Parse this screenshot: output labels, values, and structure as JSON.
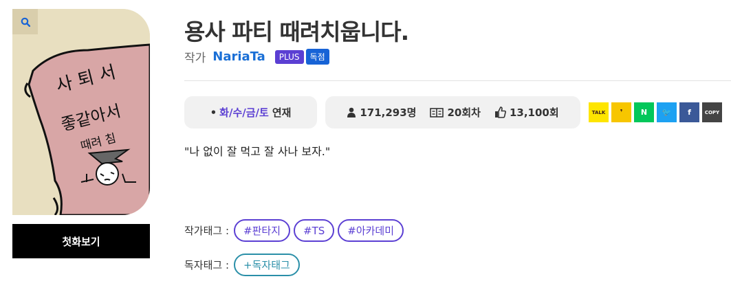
{
  "cover": {
    "zoom_icon": "search-icon",
    "handwriting_top": "사 퇴 서",
    "handwriting_mid": "좋같아서",
    "handwriting_bottom": "때려 침",
    "colors": {
      "background": "#e8dfc0",
      "paper": "#d8a6a6",
      "ink": "#111111"
    }
  },
  "first_episode_button": "첫화보기",
  "title": "용사 파티 때려치웁니다.",
  "author": {
    "label": "작가",
    "name": "NariaTa"
  },
  "badges": [
    {
      "label": "PLUS",
      "color": "#5b3fd3"
    },
    {
      "label": "독점",
      "color": "#1763d6"
    }
  ],
  "schedule": {
    "bullet": "•",
    "days": "화/수/금/토",
    "suffix": "연재"
  },
  "stats": {
    "readers": {
      "icon": "person-icon",
      "value": "171,293명"
    },
    "episodes": {
      "icon": "book-icon",
      "value": "20회차"
    },
    "likes": {
      "icon": "thumbs-up-icon",
      "value": "13,100회"
    }
  },
  "share_buttons": [
    {
      "name": "kakaotalk",
      "label": "TALK",
      "bg": "#fee500",
      "fg": "#3a1d1d"
    },
    {
      "name": "kakaostory",
      "label": "❜",
      "bg": "#f7c600",
      "fg": "#3a1d1d"
    },
    {
      "name": "naver",
      "label": "N",
      "bg": "#03c75a",
      "fg": "#ffffff"
    },
    {
      "name": "twitter",
      "label": "🐦",
      "bg": "#1da1f2",
      "fg": "#ffffff"
    },
    {
      "name": "facebook",
      "label": "f",
      "bg": "#3b5998",
      "fg": "#ffffff"
    },
    {
      "name": "copy",
      "label": "COPY",
      "bg": "#444444",
      "fg": "#ffffff"
    }
  ],
  "quote": "\"나 없이 잘 먹고 잘 사나 보자.\"",
  "author_tags": {
    "label": "작가태그 :",
    "tags": [
      "#판타지",
      "#TS",
      "#아카데미"
    ]
  },
  "reader_tags": {
    "label": "독자태그 :",
    "tags": [
      "+독자태그"
    ]
  }
}
